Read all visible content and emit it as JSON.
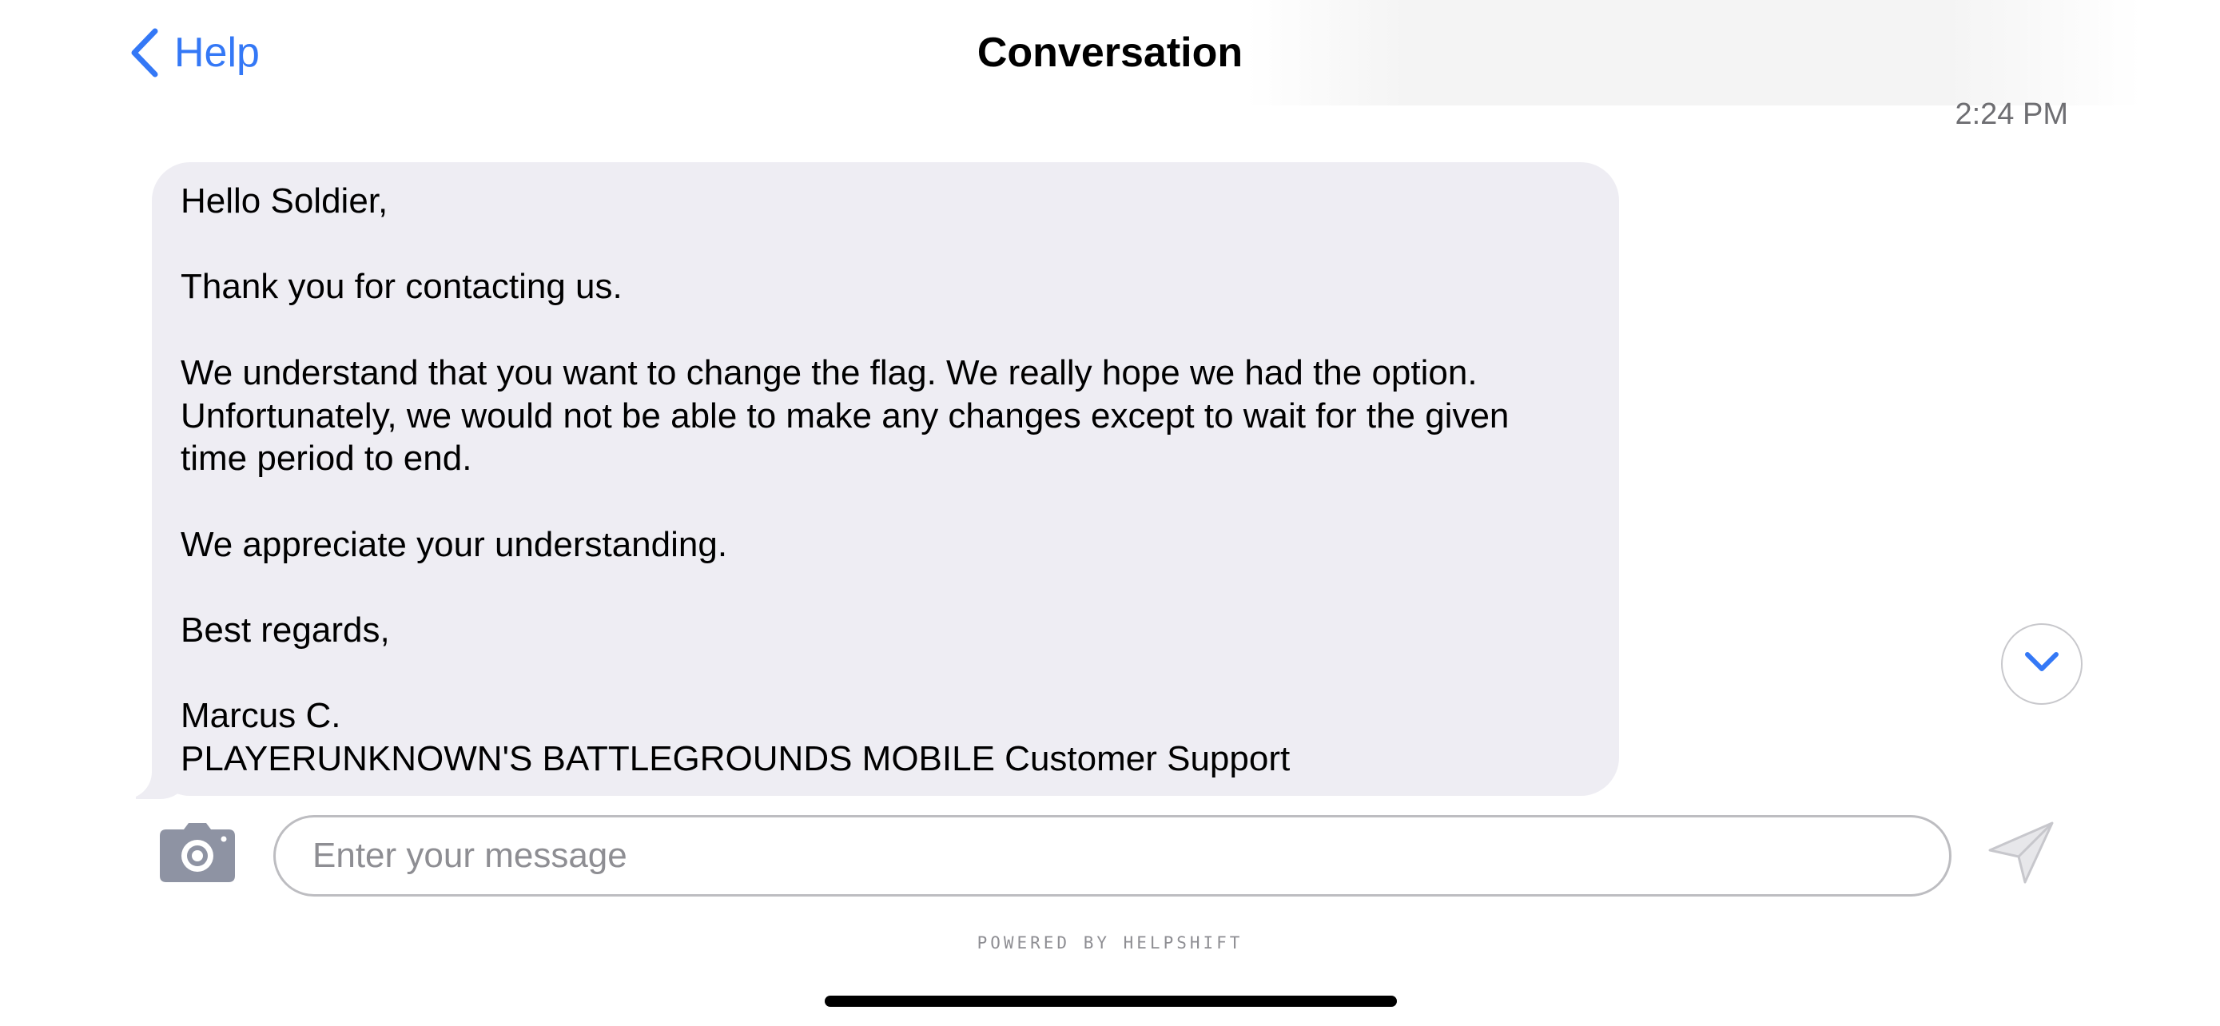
{
  "nav": {
    "back_label": "Help",
    "title": "Conversation"
  },
  "message": {
    "timestamp": "2:24 PM",
    "body": "Hello Soldier,\n\nThank you for contacting us.\n\nWe understand that you want to change the flag. We really hope we had the option.\nUnfortunately, we would not be able to make any changes except to wait for the given\ntime period to end.\n\nWe appreciate your understanding.\n\nBest regards,\n\nMarcus C.\nPLAYERUNKNOWN'S BATTLEGROUNDS MOBILE Customer Support"
  },
  "composer": {
    "placeholder": "Enter your message",
    "value": ""
  },
  "footer": {
    "powered_by": "POWERED BY HELPSHIFT"
  },
  "icons": {
    "back": "chevron-left-icon",
    "scroll": "chevron-down-icon",
    "camera": "camera-icon",
    "send": "paper-plane-icon"
  },
  "colors": {
    "accent": "#3478f6",
    "bubble": "#eeedf3",
    "send_disabled": "#c7c7cc"
  }
}
